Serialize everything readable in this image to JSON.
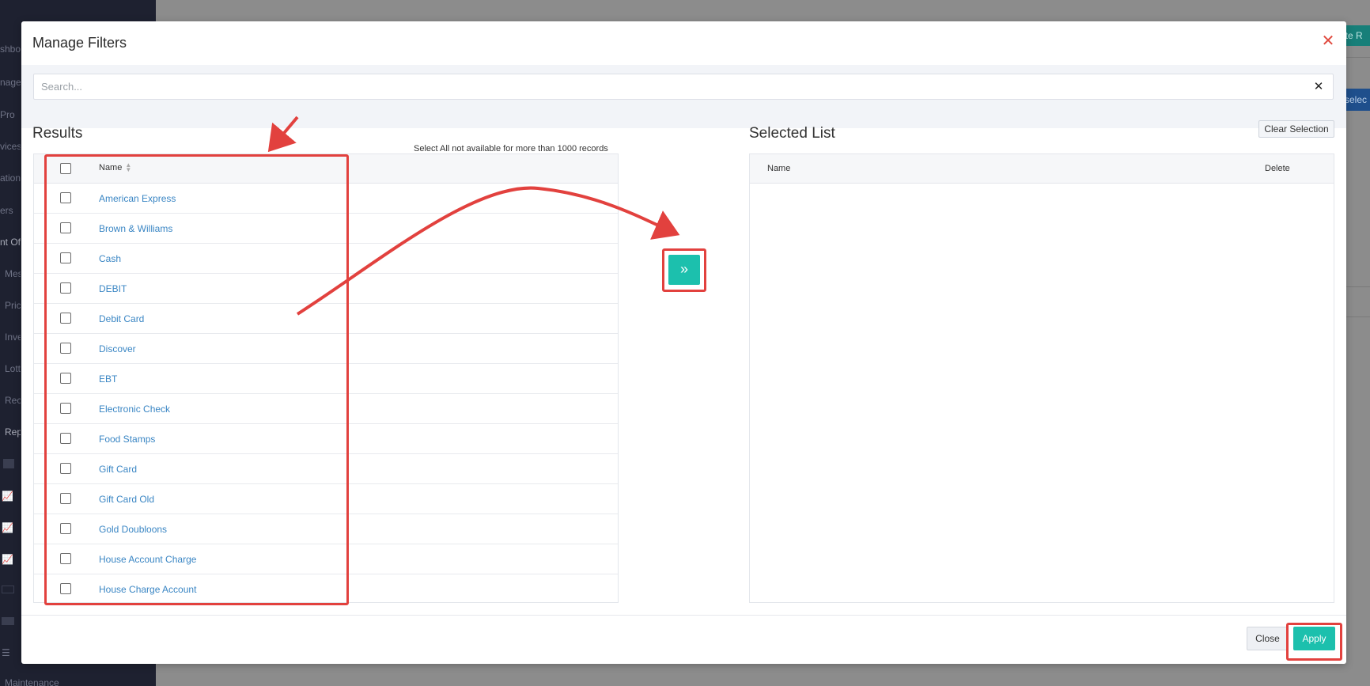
{
  "background": {
    "sidebar_fragments": [
      "shboa",
      "nage",
      "Pro",
      "vices",
      "ation",
      "ers",
      "nt Of",
      "Mes",
      "Pric",
      "Inve",
      "Lott",
      "Rec",
      "Rep",
      "Maintenance"
    ],
    "top_button_fragment": "ate R",
    "blue_button_fragment": "selec"
  },
  "modal": {
    "title": "Manage Filters",
    "close_icon": "close-x-icon",
    "search": {
      "placeholder": "Search...",
      "value": ""
    },
    "results": {
      "title": "Results",
      "note": "Select All not available for more than 1000 records",
      "column_name": "Name",
      "items": [
        "American Express",
        "Brown & Williams",
        "Cash",
        "DEBIT",
        "Debit Card",
        "Discover",
        "EBT",
        "Electronic Check",
        "Food Stamps",
        "Gift Card",
        "Gift Card Old",
        "Gold Doubloons",
        "House Account Charge",
        "House Charge Account"
      ]
    },
    "move_button_icon": "double-chevron-right-icon",
    "selected": {
      "title": "Selected List",
      "clear_label": "Clear Selection",
      "column_name": "Name",
      "column_delete": "Delete"
    },
    "footer": {
      "close_label": "Close",
      "apply_label": "Apply"
    }
  },
  "colors": {
    "accent": "#1cc0ad",
    "annotation": "#e2413e",
    "link": "#3a86c4",
    "close_icon": "#e04a3f"
  }
}
